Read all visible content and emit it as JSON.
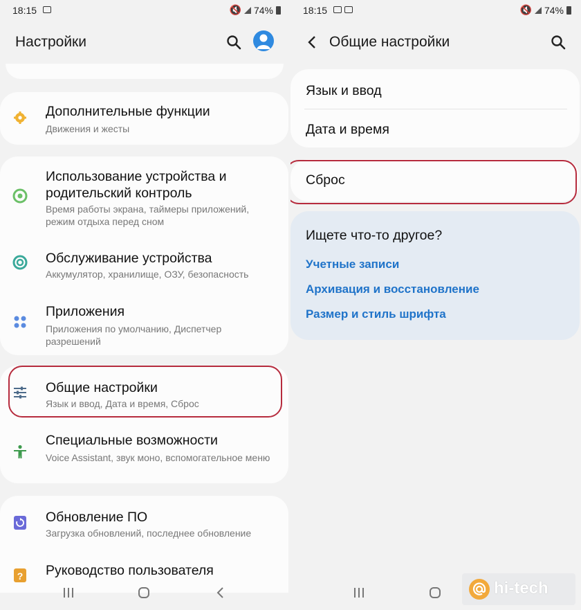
{
  "left": {
    "status": {
      "time": "18:15",
      "battery": "74%"
    },
    "title": "Настройки",
    "items": [
      {
        "title": "Дополнительные функции",
        "subtitle": "Движения и жесты",
        "icon": "gear-icon"
      },
      {
        "title": "Использование устройства и родительский контроль",
        "subtitle": "Время работы экрана, таймеры приложений, режим отдыха перед сном",
        "icon": "wellbeing-icon"
      },
      {
        "title": "Обслуживание устройства",
        "subtitle": "Аккумулятор, хранилище, ОЗУ, безопасность",
        "icon": "device-care-icon"
      },
      {
        "title": "Приложения",
        "subtitle": "Приложения по умолчанию, Диспетчер разрешений",
        "icon": "apps-icon"
      },
      {
        "title": "Общие настройки",
        "subtitle": "Язык и ввод, Дата и время, Сброс",
        "icon": "sliders-icon"
      },
      {
        "title": "Специальные возможности",
        "subtitle": "Voice Assistant, звук моно, вспомогательное меню",
        "icon": "accessibility-icon"
      },
      {
        "title": "Обновление ПО",
        "subtitle": "Загрузка обновлений, последнее обновление",
        "icon": "software-update-icon"
      },
      {
        "title": "Руководство пользователя",
        "subtitle": "",
        "icon": "user-manual-icon"
      }
    ]
  },
  "right": {
    "status": {
      "time": "18:15",
      "battery": "74%"
    },
    "title": "Общие настройки",
    "items": [
      "Язык и ввод",
      "Дата и время"
    ],
    "reset": "Сброс",
    "suggest": {
      "heading": "Ищете что-то другое?",
      "links": [
        "Учетные записи",
        "Архивация и восстановление",
        "Размер и стиль шрифта"
      ]
    }
  },
  "watermark": "hi-tech",
  "colors": {
    "highlight": "#b62b3d",
    "link": "#1f73c9",
    "avatar": "#2f8ae0"
  }
}
